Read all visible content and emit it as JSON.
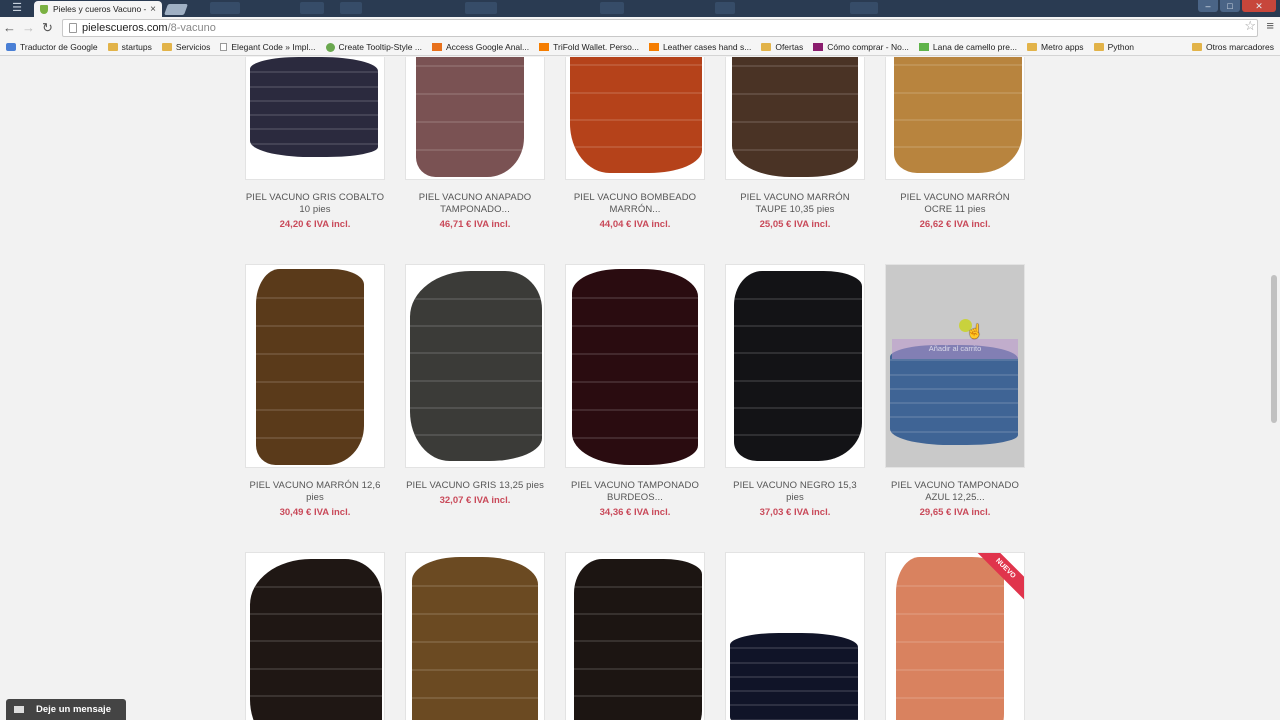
{
  "browser": {
    "tab_title": "Pieles y cueros Vacuno - P",
    "tab_close": "×",
    "url_host": "pielescueros.com",
    "url_path": "/8-vacuno",
    "bookmarks": [
      {
        "label": "Traductor de Google",
        "icon": "g"
      },
      {
        "label": "startups",
        "icon": "folder"
      },
      {
        "label": "Servicios",
        "icon": "folder"
      },
      {
        "label": "Elegant Code » Impl...",
        "icon": "page"
      },
      {
        "label": "Create Tooltip-Style ...",
        "icon": "c"
      },
      {
        "label": "Access Google Anal...",
        "icon": "ga"
      },
      {
        "label": "TriFold Wallet. Perso...",
        "icon": "b"
      },
      {
        "label": "Leather cases hand s...",
        "icon": "b"
      },
      {
        "label": "Ofertas",
        "icon": "folder"
      },
      {
        "label": "Cómo comprar - No...",
        "icon": "m"
      },
      {
        "label": "Lana de camello pre...",
        "icon": "l"
      },
      {
        "label": "Metro apps",
        "icon": "folder"
      },
      {
        "label": "Python",
        "icon": "folder"
      }
    ],
    "other_bookmarks": "Otros marcadores"
  },
  "products": [
    {
      "name": "PIEL VACUNO GRIS COBALTO 10 pies",
      "price": "24,20 € IVA incl.",
      "color": "#2b2a3e"
    },
    {
      "name": "PIEL VACUNO ANAPADO TAMPONADO...",
      "price": "46,71 € IVA incl.",
      "color": "#7a5253"
    },
    {
      "name": "PIEL VACUNO BOMBEADO MARRÓN...",
      "price": "44,04 € IVA incl.",
      "color": "#b5421a"
    },
    {
      "name": "PIEL VACUNO MARRÓN TAUPE 10,35 pies",
      "price": "25,05 € IVA incl.",
      "color": "#4a3325"
    },
    {
      "name": "PIEL VACUNO MARRÓN OCRE 11 pies",
      "price": "26,62 € IVA incl.",
      "color": "#b8843e"
    },
    {
      "name": "PIEL VACUNO MARRÓN 12,6 pies",
      "price": "30,49 € IVA incl.",
      "color": "#5a3a1a"
    },
    {
      "name": "PIEL VACUNO GRIS 13,25 pies",
      "price": "32,07 € IVA incl.",
      "color": "#3b3b38"
    },
    {
      "name": "PIEL VACUNO TAMPONADO BURDEOS...",
      "price": "34,36 € IVA incl.",
      "color": "#2a0c10"
    },
    {
      "name": "PIEL VACUNO NEGRO 15,3 pies",
      "price": "37,03 € IVA incl.",
      "color": "#131316"
    },
    {
      "name": "PIEL VACUNO TAMPONADO AZUL 12,25...",
      "price": "29,65 € IVA incl.",
      "color": "#3f6495",
      "hover_label": "Añadir al carrito"
    },
    {
      "color": "#1f1714"
    },
    {
      "color": "#6b4a22"
    },
    {
      "color": "#1c1512"
    },
    {
      "color": "#101428"
    },
    {
      "color": "#d9825f",
      "badge": "NUEVO"
    }
  ],
  "chat": {
    "label": "Deje un mensaje"
  }
}
